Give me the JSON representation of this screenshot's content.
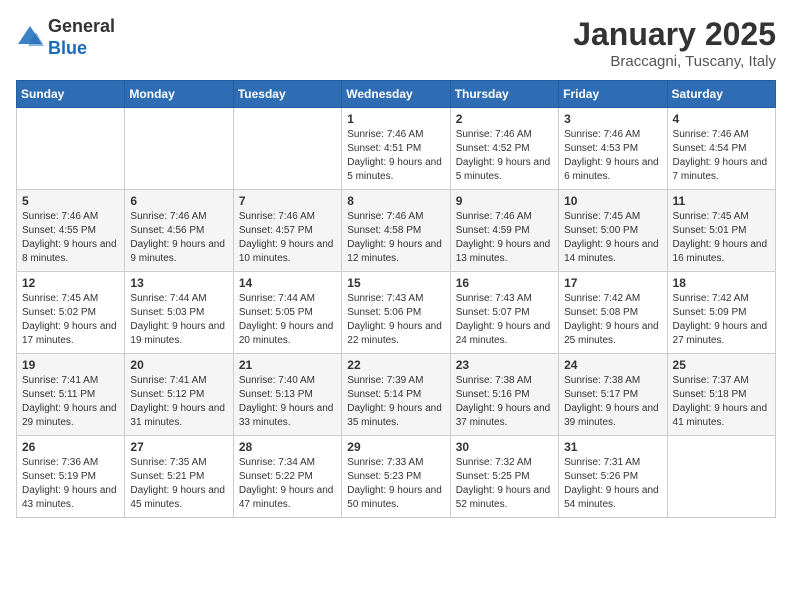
{
  "header": {
    "logo_general": "General",
    "logo_blue": "Blue",
    "month_title": "January 2025",
    "location": "Braccagni, Tuscany, Italy"
  },
  "days_of_week": [
    "Sunday",
    "Monday",
    "Tuesday",
    "Wednesday",
    "Thursday",
    "Friday",
    "Saturday"
  ],
  "weeks": [
    [
      {
        "day": "",
        "info": ""
      },
      {
        "day": "",
        "info": ""
      },
      {
        "day": "",
        "info": ""
      },
      {
        "day": "1",
        "info": "Sunrise: 7:46 AM\nSunset: 4:51 PM\nDaylight: 9 hours and 5 minutes."
      },
      {
        "day": "2",
        "info": "Sunrise: 7:46 AM\nSunset: 4:52 PM\nDaylight: 9 hours and 5 minutes."
      },
      {
        "day": "3",
        "info": "Sunrise: 7:46 AM\nSunset: 4:53 PM\nDaylight: 9 hours and 6 minutes."
      },
      {
        "day": "4",
        "info": "Sunrise: 7:46 AM\nSunset: 4:54 PM\nDaylight: 9 hours and 7 minutes."
      }
    ],
    [
      {
        "day": "5",
        "info": "Sunrise: 7:46 AM\nSunset: 4:55 PM\nDaylight: 9 hours and 8 minutes."
      },
      {
        "day": "6",
        "info": "Sunrise: 7:46 AM\nSunset: 4:56 PM\nDaylight: 9 hours and 9 minutes."
      },
      {
        "day": "7",
        "info": "Sunrise: 7:46 AM\nSunset: 4:57 PM\nDaylight: 9 hours and 10 minutes."
      },
      {
        "day": "8",
        "info": "Sunrise: 7:46 AM\nSunset: 4:58 PM\nDaylight: 9 hours and 12 minutes."
      },
      {
        "day": "9",
        "info": "Sunrise: 7:46 AM\nSunset: 4:59 PM\nDaylight: 9 hours and 13 minutes."
      },
      {
        "day": "10",
        "info": "Sunrise: 7:45 AM\nSunset: 5:00 PM\nDaylight: 9 hours and 14 minutes."
      },
      {
        "day": "11",
        "info": "Sunrise: 7:45 AM\nSunset: 5:01 PM\nDaylight: 9 hours and 16 minutes."
      }
    ],
    [
      {
        "day": "12",
        "info": "Sunrise: 7:45 AM\nSunset: 5:02 PM\nDaylight: 9 hours and 17 minutes."
      },
      {
        "day": "13",
        "info": "Sunrise: 7:44 AM\nSunset: 5:03 PM\nDaylight: 9 hours and 19 minutes."
      },
      {
        "day": "14",
        "info": "Sunrise: 7:44 AM\nSunset: 5:05 PM\nDaylight: 9 hours and 20 minutes."
      },
      {
        "day": "15",
        "info": "Sunrise: 7:43 AM\nSunset: 5:06 PM\nDaylight: 9 hours and 22 minutes."
      },
      {
        "day": "16",
        "info": "Sunrise: 7:43 AM\nSunset: 5:07 PM\nDaylight: 9 hours and 24 minutes."
      },
      {
        "day": "17",
        "info": "Sunrise: 7:42 AM\nSunset: 5:08 PM\nDaylight: 9 hours and 25 minutes."
      },
      {
        "day": "18",
        "info": "Sunrise: 7:42 AM\nSunset: 5:09 PM\nDaylight: 9 hours and 27 minutes."
      }
    ],
    [
      {
        "day": "19",
        "info": "Sunrise: 7:41 AM\nSunset: 5:11 PM\nDaylight: 9 hours and 29 minutes."
      },
      {
        "day": "20",
        "info": "Sunrise: 7:41 AM\nSunset: 5:12 PM\nDaylight: 9 hours and 31 minutes."
      },
      {
        "day": "21",
        "info": "Sunrise: 7:40 AM\nSunset: 5:13 PM\nDaylight: 9 hours and 33 minutes."
      },
      {
        "day": "22",
        "info": "Sunrise: 7:39 AM\nSunset: 5:14 PM\nDaylight: 9 hours and 35 minutes."
      },
      {
        "day": "23",
        "info": "Sunrise: 7:38 AM\nSunset: 5:16 PM\nDaylight: 9 hours and 37 minutes."
      },
      {
        "day": "24",
        "info": "Sunrise: 7:38 AM\nSunset: 5:17 PM\nDaylight: 9 hours and 39 minutes."
      },
      {
        "day": "25",
        "info": "Sunrise: 7:37 AM\nSunset: 5:18 PM\nDaylight: 9 hours and 41 minutes."
      }
    ],
    [
      {
        "day": "26",
        "info": "Sunrise: 7:36 AM\nSunset: 5:19 PM\nDaylight: 9 hours and 43 minutes."
      },
      {
        "day": "27",
        "info": "Sunrise: 7:35 AM\nSunset: 5:21 PM\nDaylight: 9 hours and 45 minutes."
      },
      {
        "day": "28",
        "info": "Sunrise: 7:34 AM\nSunset: 5:22 PM\nDaylight: 9 hours and 47 minutes."
      },
      {
        "day": "29",
        "info": "Sunrise: 7:33 AM\nSunset: 5:23 PM\nDaylight: 9 hours and 50 minutes."
      },
      {
        "day": "30",
        "info": "Sunrise: 7:32 AM\nSunset: 5:25 PM\nDaylight: 9 hours and 52 minutes."
      },
      {
        "day": "31",
        "info": "Sunrise: 7:31 AM\nSunset: 5:26 PM\nDaylight: 9 hours and 54 minutes."
      },
      {
        "day": "",
        "info": ""
      }
    ]
  ]
}
